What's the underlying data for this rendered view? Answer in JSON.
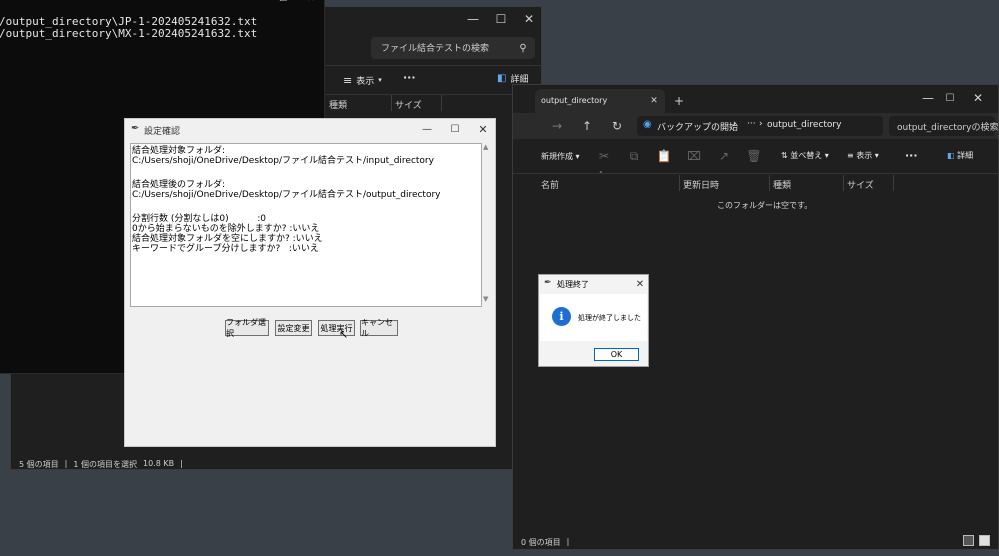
{
  "terminal": {
    "lines": [
      "/output_directory\\JP-1-202405241632.txt",
      "/output_directory\\MX-1-202405241632.txt"
    ]
  },
  "explorer_back": {
    "search_placeholder": "ファイル結合テストの検索",
    "view_label": "表示",
    "details_label": "詳細",
    "col_type": "種類",
    "col_size": "サイズ",
    "status_items": "5 個の項目",
    "status_selected": "1 個の項目を選択",
    "status_size": "10.8 KB"
  },
  "explorer_front": {
    "tab_title": "output_directory",
    "breadcrumb_root": "バックアップの開始",
    "breadcrumb_folder": "output_directory",
    "search_placeholder": "output_directoryの検索",
    "new_label": "新規作成",
    "sort_label": "並べ替え",
    "view_label": "表示",
    "details_label": "詳細",
    "col_name": "名前",
    "col_date": "更新日時",
    "col_type": "種類",
    "col_size": "サイズ",
    "empty_text": "このフォルダーは空です。",
    "status_items": "0 個の項目"
  },
  "settings_dialog": {
    "title": "設定確認",
    "text_lines": [
      "結合処理対象フォルダ:",
      "C:/Users/shoji/OneDrive/Desktop/ファイル結合テスト/input_directory",
      "",
      "結合処理後のフォルダ:",
      "C:/Users/shoji/OneDrive/Desktop/ファイル結合テスト/output_directory",
      "",
      "分割行数 (分割なしは0)          :0",
      "0から始まらないものを除外しますか? :いいえ",
      "結合処理対象フォルダを空にしますか? :いいえ",
      "キーワードでグループ分けしますか?   :いいえ"
    ],
    "buttons": {
      "folder_select": "フォルダ選択",
      "settings_change": "設定変更",
      "run": "処理実行",
      "cancel": "キャンセル"
    }
  },
  "message_box": {
    "title": "処理終了",
    "message": "処理が終了しました",
    "ok_label": "OK"
  }
}
